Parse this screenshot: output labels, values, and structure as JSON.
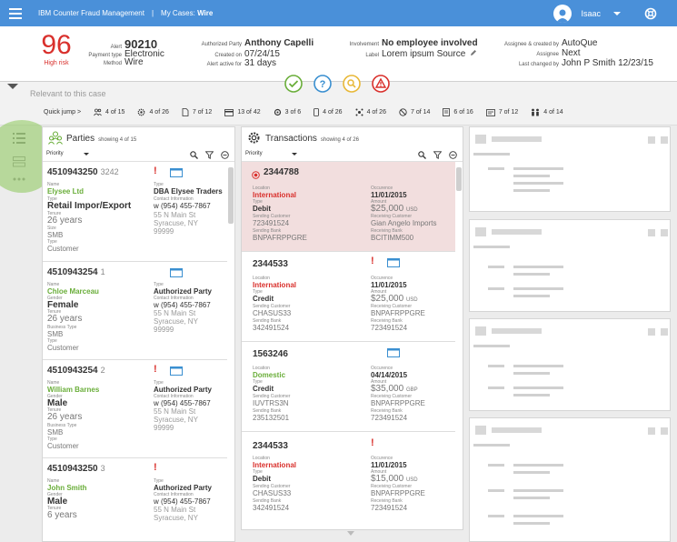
{
  "topbar": {
    "app_title": "IBM Counter Fraud Management",
    "separator": "|",
    "crumb_prefix": "My Cases:",
    "crumb_current": "Wire",
    "user_name": "Isaac"
  },
  "case": {
    "risk_score": "96",
    "risk_label": "High risk",
    "alert_label": "Alert",
    "alert_value": "90210",
    "payment_type_label": "Payment type",
    "payment_type_value": "Electronic",
    "method_label": "Method",
    "method_value": "Wire",
    "authorized_party_label": "Authorized Party",
    "authorized_party_value": "Anthony Capelli",
    "created_on_label": "Created on",
    "created_on_value": "07/24/15",
    "alert_active_label": "Alert active for",
    "alert_active_value": "31 days",
    "involvement_label": "Involvement",
    "involvement_value": "No employee involved",
    "label_label": "Label",
    "label_value": "Lorem ipsum Source",
    "assignee_created_label": "Assignee & created by",
    "assignee_created_value": "AutoQue",
    "assignee_label": "Assignee",
    "assignee_value": "Next",
    "last_changed_label": "Last changed by",
    "last_changed_value": "John P Smith 12/23/15"
  },
  "relevant": {
    "title": "Relevant to this case",
    "quick_jump_label": "Quick jump >",
    "quick_items": [
      "4 of 15",
      "4 of 26",
      "7 of 12",
      "13 of 42",
      "3 of 6",
      "4 of 26",
      "4 of 26",
      "7 of 14",
      "6 of 16",
      "7 of 12",
      "4 of 14"
    ]
  },
  "parties": {
    "title": "Parties",
    "count": "showing 4 of 15",
    "sort": "Priority",
    "cards": [
      {
        "id": "4510943250",
        "sub": "3242",
        "f1_label": "Name",
        "f1_value": "Elysee Ltd",
        "f2_label": "Type",
        "f2_value": "Retail Impor/Export",
        "f3_label": "Tenure",
        "f3_value": "26 years",
        "f4_label": "Size",
        "f4_value": "SMB",
        "f5_label": "Type",
        "f5_value": "Customer",
        "r1_label": "Type",
        "r1_value": "DBA Elysee Traders",
        "r2_label": "Contact Information",
        "r2_value": "w (954) 455-7867",
        "addr1": "55 N Main St",
        "addr2": "Syracuse, NY",
        "addr3": "99999"
      },
      {
        "id": "4510943254",
        "sub": "1",
        "f1_label": "Name",
        "f1_value": "Chloe Marceau",
        "f2_label": "Gender",
        "f2_value": "Female",
        "f3_label": "Tenure",
        "f3_value": "26 years",
        "f4_label": "Business Type",
        "f4_value": "SMB",
        "f5_label": "Type",
        "f5_value": "Customer",
        "r1_label": "Type",
        "r1_value": "Authorized Party",
        "r2_label": "Contact Information",
        "r2_value": "w (954) 455-7867",
        "addr1": "55 N Main St",
        "addr2": "Syracuse, NY",
        "addr3": "99999"
      },
      {
        "id": "4510943254",
        "sub": "2",
        "f1_label": "Name",
        "f1_value": "William Barnes",
        "f2_label": "Gender",
        "f2_value": "Male",
        "f3_label": "Tenure",
        "f3_value": "26 years",
        "f4_label": "Business Type",
        "f4_value": "SMB",
        "f5_label": "Type",
        "f5_value": "Customer",
        "r1_label": "Type",
        "r1_value": "Authorized Party",
        "r2_label": "Contact Information",
        "r2_value": "w (954) 455-7867",
        "addr1": "55 N Main St",
        "addr2": "Syracuse, NY",
        "addr3": "99999"
      },
      {
        "id": "4510943250",
        "sub": "3",
        "f1_label": "Name",
        "f1_value": "John Smith",
        "f2_label": "Gender",
        "f2_value": "Male",
        "f3_label": "Tenure",
        "f3_value": "6 years",
        "r1_label": "Type",
        "r1_value": "Authorized Party",
        "r2_label": "Contact Information",
        "r2_value": "w (954) 455-7867",
        "addr1": "55 N Main St",
        "addr2": "Syracuse, NY"
      }
    ]
  },
  "transactions": {
    "title": "Transactions",
    "count": "showing 4 of 26",
    "sort": "Priority",
    "cards": [
      {
        "id": "2344788",
        "loc_label": "Location",
        "loc_value": "International",
        "type_label": "Type",
        "type_value": "Debit",
        "send_cust_label": "Sending Customer",
        "send_cust_value": "723491524",
        "send_bank_label": "Sending Bank",
        "send_bank_value": "BNPAFRPPGRE",
        "occ_label": "Occurence",
        "occ_value": "11/01/2015",
        "amt_label": "Amount",
        "amt_value": "$25,000",
        "amt_cur": "USD",
        "recv_cust_label": "Receiving Customer",
        "recv_cust_value": "Gian Angelo Imports",
        "recv_bank_label": "Receiving Bank",
        "recv_bank_value": "BCITIMM500"
      },
      {
        "id": "2344533",
        "loc_label": "Location",
        "loc_value": "International",
        "type_label": "Type",
        "type_value": "Credit",
        "send_cust_label": "Sending Customer",
        "send_cust_value": "CHASUS33",
        "send_bank_label": "Sending Bank",
        "send_bank_value": "342491524",
        "occ_label": "Occurence",
        "occ_value": "11/01/2015",
        "amt_label": "Amount",
        "amt_value": "$25,000",
        "amt_cur": "USD",
        "recv_cust_label": "Receiving Customer",
        "recv_cust_value": "BNPAFRPPGRE",
        "recv_bank_label": "Receiving Bank",
        "recv_bank_value": "723491524"
      },
      {
        "id": "1563246",
        "loc_label": "Location",
        "loc_value": "Domestic",
        "type_label": "Type",
        "type_value": "Credit",
        "send_cust_label": "Sending Customer",
        "send_cust_value": "IUVTRS3N",
        "send_bank_label": "Sending Bank",
        "send_bank_value": "235132501",
        "occ_label": "Occurence",
        "occ_value": "04/14/2015",
        "amt_label": "Amount",
        "amt_value": "$35,000",
        "amt_cur": "GBP",
        "recv_cust_label": "Receiving Customer",
        "recv_cust_value": "BNPAFRPPGRE",
        "recv_bank_label": "Receiving Bank",
        "recv_bank_value": "723491524"
      },
      {
        "id": "2344533",
        "loc_label": "Location",
        "loc_value": "International",
        "type_label": "Type",
        "type_value": "Debit",
        "send_cust_label": "Sending Customer",
        "send_cust_value": "CHASUS33",
        "send_bank_label": "Sending Bank",
        "send_bank_value": "342491524",
        "occ_label": "Occurence",
        "occ_value": "11/01/2015",
        "amt_label": "Amount",
        "amt_value": "$15,000",
        "amt_cur": "USD",
        "recv_cust_label": "Receiving Customer",
        "recv_cust_value": "BNPAFRPPGRE",
        "recv_bank_label": "Receiving Bank",
        "recv_bank_value": "723491524"
      }
    ]
  },
  "colors": {
    "brand": "#4a90d9",
    "risk": "#d9302c",
    "green": "#6aae3a",
    "highlight": "#f2dede"
  }
}
